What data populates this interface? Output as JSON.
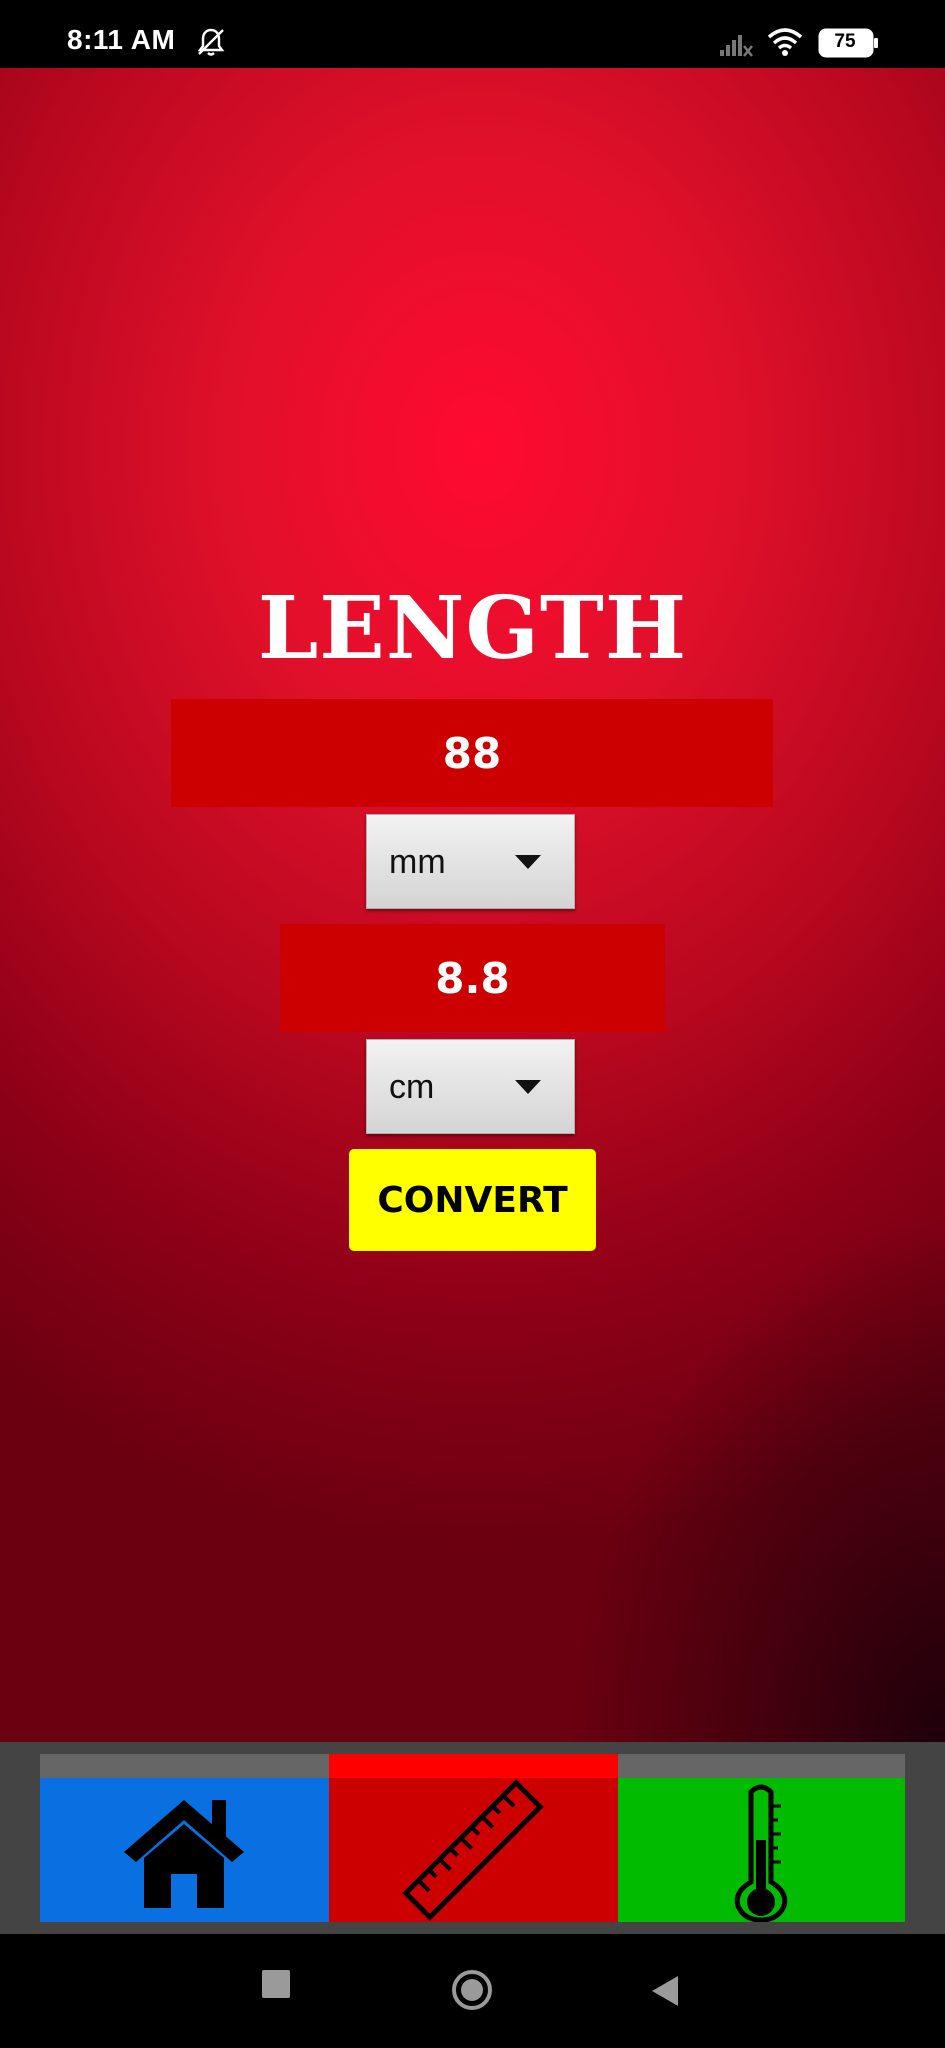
{
  "status_bar": {
    "time": "8:11 AM",
    "battery": "75",
    "icons": [
      "notifications-off-icon",
      "signal-icon",
      "wifi-icon",
      "battery-icon"
    ]
  },
  "main": {
    "title": "LENGTH",
    "input_value": "88",
    "from_unit": "mm",
    "output_value": "8.8",
    "to_unit": "cm",
    "convert_label": "CONVERT"
  },
  "bottom_nav": {
    "tabs": [
      {
        "icon": "home-icon",
        "selected": false,
        "color": "#0a6fe0"
      },
      {
        "icon": "ruler-icon",
        "selected": true,
        "color": "#cc0000"
      },
      {
        "icon": "thermometer-icon",
        "selected": false,
        "color": "#00bb00"
      }
    ]
  },
  "colors": {
    "background": "#e0102a",
    "value_box": "#cc0000",
    "convert_button": "#ffff00"
  }
}
